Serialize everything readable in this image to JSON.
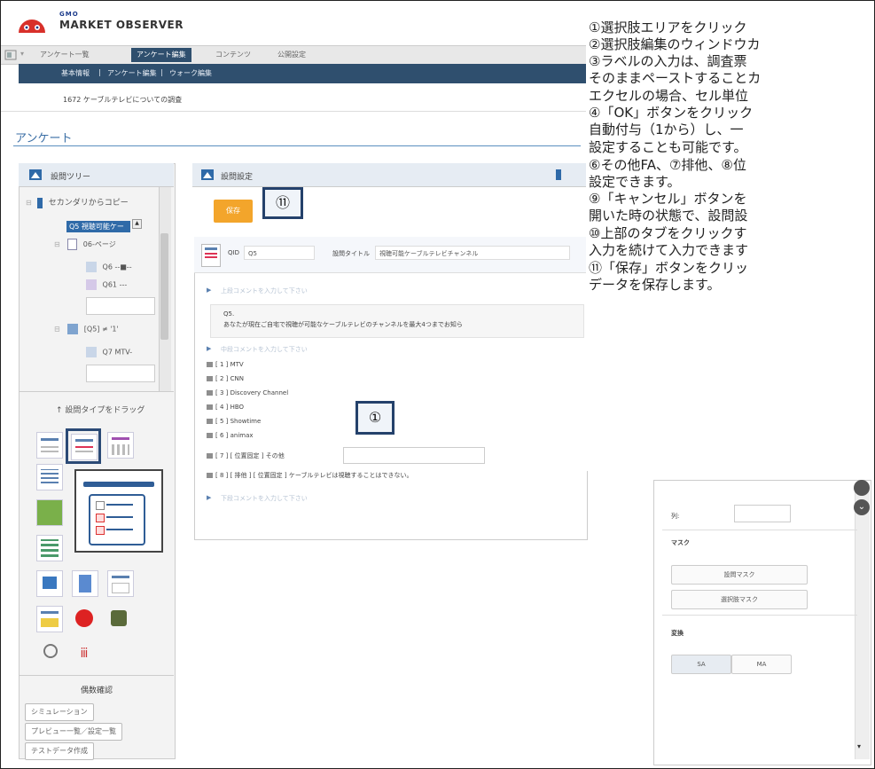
{
  "header": {
    "gmo": "GMO",
    "brand": "MARKET OBSERVER"
  },
  "tabs": [
    {
      "label": "アンケート一覧"
    },
    {
      "label": "アンケート編集"
    },
    {
      "label": "コンテンツ"
    },
    {
      "label": "公開設定"
    }
  ],
  "subnav": {
    "items": [
      "基本情報",
      "|",
      "アンケート編集",
      "|",
      "ウォーク編集"
    ]
  },
  "survey_title": "1672 ケーブルテレビについての調査",
  "page_title": "アンケート",
  "sidebar": {
    "tree_title": "設問ツリー",
    "copy_label": "セカンダリからコピー",
    "tree_items": [
      "Q5 視聴可能ケー",
      "06-ページ",
      "Q6 --■--",
      "Q61 ---",
      "[Q5] ≠ '1'",
      "Q7 MTV-"
    ],
    "drag_label": "↑ 設問タイプをドラッグ",
    "check_title": "偶数確認",
    "buttons": [
      "シミュレーション",
      "プレビュー一覧／設定一覧",
      "テストデータ作成"
    ]
  },
  "settings": {
    "title": "設問設定",
    "save": "保存",
    "qid_label": "QID",
    "qid_value": "Q5",
    "qtitle_label": "設問タイトル",
    "qtitle_value": "視聴可能ケーブルテレビチャンネル",
    "top_comment_ph": "上段コメントを入力して下さい",
    "question_no": "Q5.",
    "question_text": "あなたが現在ご自宅で視聴が可能なケーブルテレビのチャンネルを最大4つまでお知ら",
    "mid_comment_ph": "中段コメントを入力して下さい",
    "options": [
      "[ 1 ] MTV",
      "[ 2 ] CNN",
      "[ 3 ] Discovery Channel",
      "[ 4 ] HBO",
      "[ 5 ] Showtime",
      "[ 6 ] animax",
      "[ 7 ] [ 位置固定 ] その他",
      "[ 8 ] [ 排他 ] [ 位置固定 ] ケーブルテレビは視聴することはできない。"
    ],
    "bottom_comment_ph": "下段コメントを入力して下さい"
  },
  "callouts": {
    "one": "①",
    "eleven": "⑪"
  },
  "instructions": [
    "①選択肢エリアをクリック",
    "②選択肢編集のウィンドウカ",
    "③ラベルの入力は、調査票",
    "そのままペーストすることカ",
    "エクセルの場合、セル単位",
    "④「OK」ボタンをクリック",
    "自動付与（1から）し、一",
    "設定することも可能です。",
    "⑥その他FA、⑦排他、⑧位",
    "設定できます。",
    "⑨「キャンセル」ボタンを",
    "開いた時の状態で、設問設",
    "⑩上部のタブをクリックす",
    "入力を続けて入力できます",
    "⑪「保存」ボタンをクリッ",
    "データを保存します。"
  ],
  "right_panel": {
    "row_label": "列:",
    "mask_title": "マスク",
    "q_mask": "設問マスク",
    "opt_mask": "選択肢マスク",
    "convert_title": "変換",
    "sa": "SA",
    "ma": "MA"
  },
  "colors": {
    "navy": "#2f4f6e",
    "orange": "#f3a52b",
    "callout_border": "#24416b",
    "link_blue": "#3a6ea5"
  }
}
